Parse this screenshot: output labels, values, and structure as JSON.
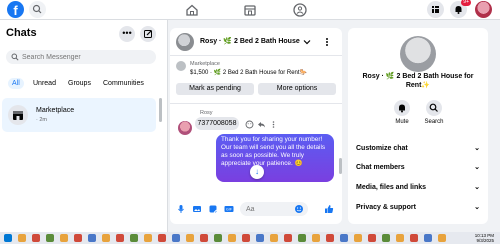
{
  "header": {
    "logo": "f",
    "nav_icons": [
      "home-icon",
      "store-icon",
      "groups-icon"
    ],
    "right_icons": [
      "menu-grid-icon",
      "notifications-icon",
      "profile-avatar-icon"
    ],
    "notification_count": "9+"
  },
  "sidebar": {
    "title": "Chats",
    "search_placeholder": "Search Messenger",
    "tabs": [
      "All",
      "Unread",
      "Groups",
      "Communities"
    ],
    "conversations": [
      {
        "name": "Marketplace",
        "time": "· 2m"
      }
    ]
  },
  "chat": {
    "title": "Rosy · 🌿 2 Bed 2 Bath House f",
    "marketplace_label": "Marketplace",
    "listing": "$1,500 · 🌿 2 Bed 2 Bath House for Rent🐎",
    "mark_pending_label": "Mark as pending",
    "more_options_label": "More options",
    "sender_name": "Rosy",
    "incoming_message": "7377008058",
    "outgoing_message": "Thank you for sharing your number!     Our team will send you all the details as soon as possible. We truly appreciate your patience. 😊",
    "composer_placeholder": "Aa"
  },
  "details": {
    "name": "Rosy · 🌿 2 Bed 2 Bath House for Rent✨",
    "mute_label": "Mute",
    "search_label": "Search",
    "settings": [
      "Customize chat",
      "Chat members",
      "Media, files and links",
      "Privacy & support"
    ]
  },
  "taskbar": {
    "time": "10:13 PM",
    "date": "9/3/2025"
  },
  "colors": {
    "accent": "#1877f2",
    "bubble_gradient_start": "#5b5df2",
    "bubble_gradient_end": "#7a3fe0",
    "selected_bg": "#ebf5ff"
  }
}
